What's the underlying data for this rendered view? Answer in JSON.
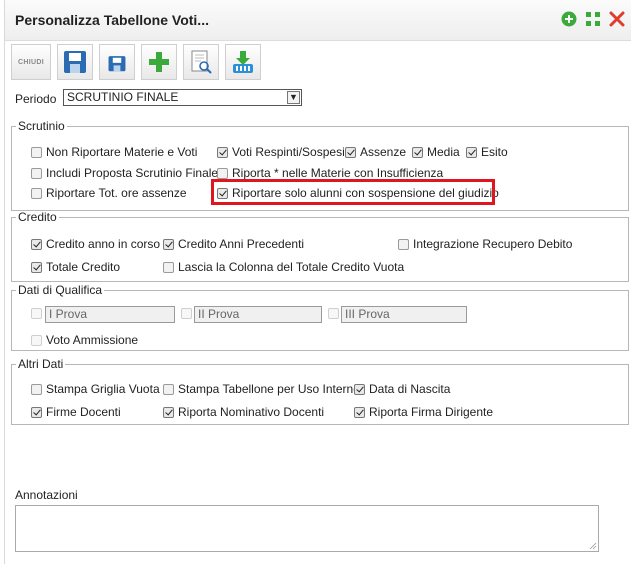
{
  "window": {
    "title": "Personalizza Tabellone Voti...",
    "icons": [
      "plus-circle-icon",
      "expand-icon",
      "close-icon"
    ]
  },
  "toolbar": {
    "chiudi_label": "CHIUDI",
    "buttons": [
      "save-icon",
      "save-small-icon",
      "add-icon",
      "print-preview-icon",
      "download-icon"
    ]
  },
  "periodo": {
    "label": "Periodo",
    "selected": "SCRUTINIO FINALE"
  },
  "scrutinio": {
    "legend": "Scrutinio",
    "items": [
      {
        "label": "Non Riportare Materie e Voti",
        "checked": false
      },
      {
        "label": "Voti Respinti/Sospesi",
        "checked": true
      },
      {
        "label": "Assenze",
        "checked": true
      },
      {
        "label": "Media",
        "checked": true
      },
      {
        "label": "Esito",
        "checked": true
      },
      {
        "label": "Includi Proposta Scrutinio Finale",
        "checked": false
      },
      {
        "label": "Riporta * nelle Materie con Insufficienza",
        "checked": false
      },
      {
        "label": "Riportare Tot. ore assenze",
        "checked": false
      },
      {
        "label": "Riportare solo alunni con sospensione del giudizio",
        "checked": true
      }
    ]
  },
  "credito": {
    "legend": "Credito",
    "items": [
      {
        "label": "Credito anno in corso",
        "checked": true
      },
      {
        "label": "Credito Anni Precedenti",
        "checked": true
      },
      {
        "label": "Integrazione Recupero Debito",
        "checked": false
      },
      {
        "label": "Totale Credito",
        "checked": true
      },
      {
        "label": "Lascia la Colonna del Totale Credito Vuota",
        "checked": false
      }
    ]
  },
  "qualifica": {
    "legend": "Dati di Qualifica",
    "inputs": [
      "I Prova",
      "II Prova",
      "III Prova"
    ],
    "voto_label": "Voto Ammissione"
  },
  "altri": {
    "legend": "Altri Dati",
    "items": [
      {
        "label": "Stampa Griglia Vuota",
        "checked": false
      },
      {
        "label": "Stampa Tabellone per Uso Interno",
        "checked": false
      },
      {
        "label": "Data di Nascita",
        "checked": true
      },
      {
        "label": "Firme Docenti",
        "checked": true
      },
      {
        "label": "Riporta Nominativo Docenti",
        "checked": true
      },
      {
        "label": "Riporta Firma Dirigente",
        "checked": true
      }
    ]
  },
  "annotazioni": {
    "label": "Annotazioni",
    "value": ""
  },
  "colors": {
    "highlight": "#e0161e",
    "toolbar_blue": "#2a6bb3",
    "green": "#3aab3a",
    "close_red": "#e23b2e"
  }
}
